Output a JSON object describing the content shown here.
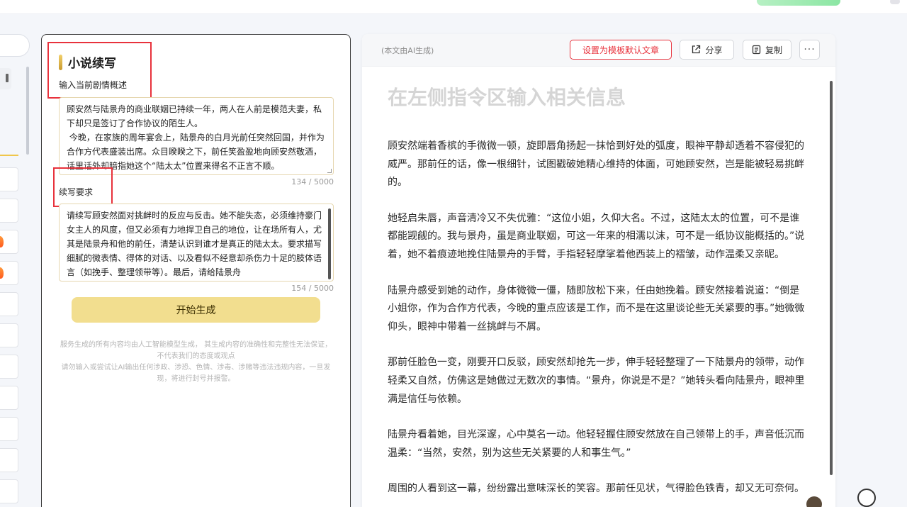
{
  "left_panel": {
    "title": "小说续写",
    "label_summary": "输入当前剧情概述",
    "summary_text": "顾安然与陆景舟的商业联姻已持续一年，两人在人前是模范夫妻，私下却只是签订了合作协议的陌生人。\n 今晚，在家族的周年宴会上，陆景舟的白月光前任突然回国，并作为合作方代表盛装出席。众目睽睽之下，前任笑盈盈地向顾安然敬酒，话里话外却暗指她这个“陆太太”位置来得名不正言不顺。",
    "summary_count": "134 / 5000",
    "label_requirement": "续写要求",
    "requirement_text": "请续写顾安然面对挑衅时的反应与反击。她不能失态，必须维持豪门女主人的风度，但又必须有力地捍卫自己的地位，让在场所有人，尤其是陆景舟和他的前任，清楚认识到谁才是真正的陆太太。要求描写细腻的微表情、得体的对话、以及看似不经意却杀伤力十足的肢体语言（如挽手、整理领带等）。最后，请给陆景舟",
    "requirement_count": "154 / 5000",
    "generate_button": "开始生成",
    "disclaimer_1": "服务生成的所有内容均由人工智能模型生成， 其生成内容的准确性和完整性无法保证， 不代表我们的态度或观点",
    "disclaimer_2": "请勿输入或尝试让AI输出任何涉政、涉恐、色情、涉毒、涉赌等违法违规内容，一旦发现，将进行封号并报警。"
  },
  "right_panel": {
    "ai_note": "(本文由AI生成)",
    "set_default_button": "设置为模板默认文章",
    "share_button": "分享",
    "copy_button": "复制",
    "more_button": "···",
    "doc_title": "在左侧指令区输入相关信息",
    "paragraphs": [
      "顾安然端着香槟的手微微一顿，旋即唇角扬起一抹恰到好处的弧度，眼神平静却透着不容侵犯的威严。那前任的话，像一根细针，试图戳破她精心维持的体面，可她顾安然，岂是能被轻易挑衅的。",
      "她轻启朱唇，声音清冷又不失优雅：“这位小姐，久仰大名。不过，这陆太太的位置，可不是谁都能觊觎的。我与景舟，虽是商业联姻，可这一年来的相濡以沫，可不是一纸协议能概括的。”说着，她不着痕迹地挽住陆景舟的手臂，手指轻轻摩挲着他西装上的褶皱，动作温柔又亲昵。",
      "陆景舟感受到她的动作，身体微微一僵，随即放松下来，任由她挽着。顾安然接着说道：“倒是小姐你，作为合作方代表，今晚的重点应该是工作，而不是在这里谈论些无关紧要的事。”她微微仰头，眼神中带着一丝挑衅与不屑。",
      "那前任脸色一变，刚要开口反驳，顾安然却抢先一步，伸手轻轻整理了一下陆景舟的领带，动作轻柔又自然，仿佛这是她做过无数次的事情。“景舟，你说是不是？”她转头看向陆景舟，眼神里满是信任与依赖。",
      "陆景舟看着她，目光深邃，心中莫名一动。他轻轻握住顾安然放在自己领带上的手，声音低沉而温柔：“当然，安然，别为这些无关紧要的人和事生气。”",
      "周围的人看到这一幕，纷纷露出意味深长的笑容。那前任见状，气得脸色铁青，却又无可奈何。"
    ]
  },
  "colors": {
    "accent_red": "#e8323c",
    "button_yellow": "#f2de8f",
    "title_gold": "#d9ad3d"
  }
}
